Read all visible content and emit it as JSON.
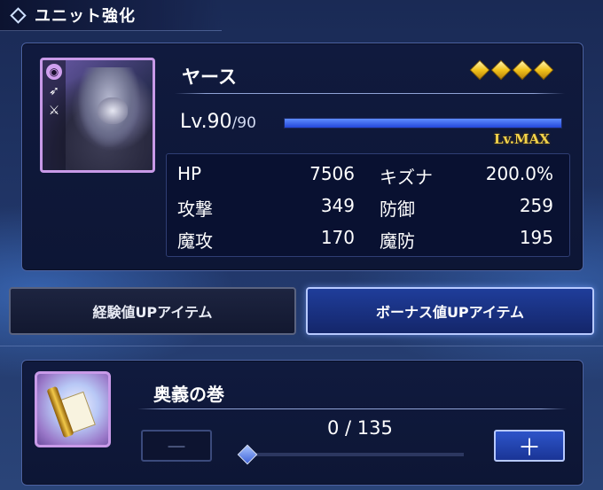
{
  "title": "ユニット強化",
  "unit": {
    "name": "ヤース",
    "rarity": 4,
    "level_label": "Lv.90",
    "level_max_label": "/90",
    "level_progress": 1.0,
    "max_badge": "Lv.MAX",
    "stats": [
      {
        "l1": "HP",
        "v1": "7506",
        "l2": "キズナ",
        "v2": "200.0%"
      },
      {
        "l1": "攻撃",
        "v1": "349",
        "l2": "防御",
        "v2": "259"
      },
      {
        "l1": "魔攻",
        "v1": "170",
        "l2": "魔防",
        "v2": "195"
      }
    ]
  },
  "tabs": {
    "exp": "経験値UPアイテム",
    "bonus": "ボーナス値UPアイテム",
    "selected": "bonus"
  },
  "item": {
    "name": "奥義の巻",
    "count_label": "0 / 135",
    "minus": "－",
    "plus": "＋"
  },
  "icons": {
    "title": "diamond-icon",
    "gem": "gold-diamond-icon",
    "item": "scroll-icon"
  }
}
